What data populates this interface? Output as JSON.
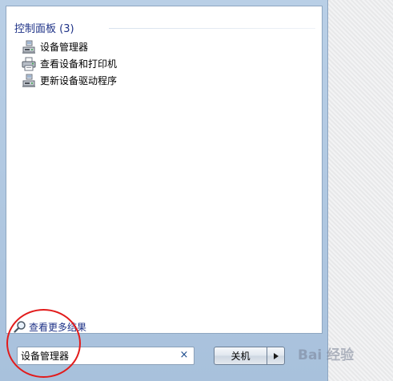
{
  "results": {
    "group_title": "控制面板 (3)",
    "items": [
      {
        "label": "设备管理器",
        "icon": "device-manager-icon"
      },
      {
        "label": "查看设备和打印机",
        "icon": "printer-icon"
      },
      {
        "label": "更新设备驱动程序",
        "icon": "device-manager-icon"
      }
    ]
  },
  "see_more": {
    "label": "查看更多结果",
    "icon": "search-icon"
  },
  "search": {
    "value": "设备管理器",
    "clear_glyph": "×"
  },
  "shutdown": {
    "label": "关机"
  },
  "watermark": {
    "text": "Bai 经验"
  },
  "colors": {
    "link_blue": "#1e3287",
    "annotation_red": "#e21b1b",
    "frame_blue": "#b9cfe6"
  }
}
